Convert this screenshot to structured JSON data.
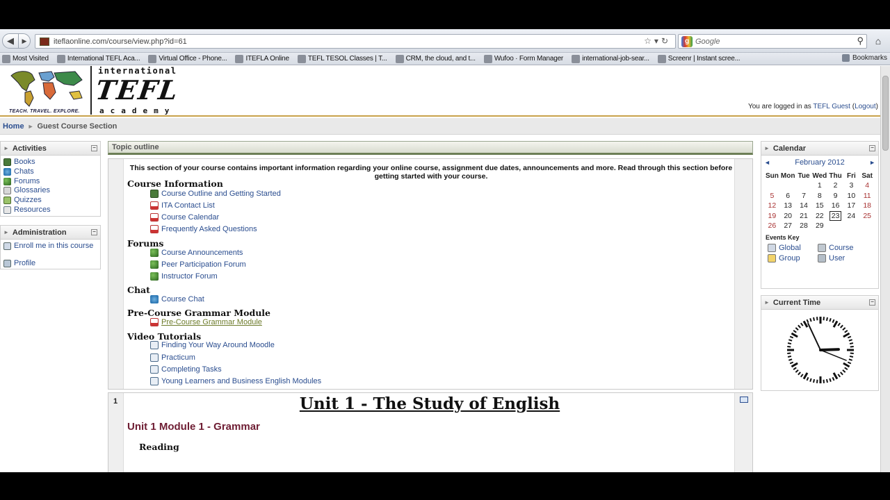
{
  "browser": {
    "url": "iteflaonline.com/course/view.php?id=61",
    "search_placeholder": "Google",
    "bookmarks": [
      "Most Visited",
      "International TEFL Aca...",
      "Virtual Office - Phone...",
      "ITEFLA Online",
      "TEFL TESOL Classes | T...",
      "CRM, the cloud, and t...",
      "Wufoo · Form Manager",
      "international-job-sear...",
      "Screenr | Instant scree..."
    ],
    "bookmarks_menu": "Bookmarks"
  },
  "header": {
    "logo_intl": "international",
    "logo_tefl": "TEFL",
    "logo_academy": "academy",
    "logo_tagline": "TEACH. TRAVEL. EXPLORE.",
    "login_prefix": "You are logged in as ",
    "login_user": "TEFL Guest",
    "logout": "Logout"
  },
  "breadcrumb": {
    "home": "Home",
    "separator": "►",
    "current": "Guest Course Section"
  },
  "activities": {
    "title": "Activities",
    "items": [
      {
        "label": "Books",
        "icon": "book-icon"
      },
      {
        "label": "Chats",
        "icon": "chat-icon"
      },
      {
        "label": "Forums",
        "icon": "forum-icon"
      },
      {
        "label": "Glossaries",
        "icon": "glossary-icon"
      },
      {
        "label": "Quizzes",
        "icon": "quiz-icon"
      },
      {
        "label": "Resources",
        "icon": "resource-icon"
      }
    ]
  },
  "administration": {
    "title": "Administration",
    "items": [
      {
        "label": "Enroll me in this course",
        "icon": "enroll-icon"
      },
      {
        "label": "Profile",
        "icon": "profile-icon"
      }
    ]
  },
  "topic": {
    "heading": "Topic outline",
    "summary": "This section of your course contains important information regarding your online course, assignment due dates, announcements and more. Read through this section before getting started with your course.",
    "sections": [
      {
        "title": "Course Information",
        "items": [
          {
            "label": "Course Outline and Getting Started",
            "icon": "book-icon"
          },
          {
            "label": "ITA Contact List",
            "icon": "pdf-icon"
          },
          {
            "label": "Course Calendar",
            "icon": "pdf-icon"
          },
          {
            "label": "Frequently Asked Questions",
            "icon": "pdf-icon"
          }
        ]
      },
      {
        "title": "Forums",
        "items": [
          {
            "label": "Course Announcements",
            "icon": "forum-icon"
          },
          {
            "label": "Peer Participation Forum",
            "icon": "forum-icon"
          },
          {
            "label": "Instructor Forum",
            "icon": "forum-icon"
          }
        ]
      },
      {
        "title": "Chat",
        "items": [
          {
            "label": "Course Chat",
            "icon": "chat-icon"
          }
        ]
      },
      {
        "title": "Pre-Course Grammar Module",
        "items": [
          {
            "label": "Pre-Course Grammar Module",
            "icon": "pdf-icon"
          }
        ]
      },
      {
        "title": "Video Tutorials",
        "items": [
          {
            "label": "Finding Your Way Around Moodle",
            "icon": "video-icon"
          },
          {
            "label": "Practicum",
            "icon": "video-icon"
          },
          {
            "label": "Completing Tasks",
            "icon": "video-icon"
          },
          {
            "label": "Young Learners and Business English Modules",
            "icon": "video-icon"
          }
        ]
      }
    ]
  },
  "unit": {
    "number": "1",
    "title": "Unit 1 - The Study of English",
    "module": "Unit 1 Module 1 - Grammar",
    "reading": "Reading"
  },
  "calendar": {
    "title": "Calendar",
    "month": "February 2012",
    "prev": "◄",
    "next": "►",
    "days": [
      "Sun",
      "Mon",
      "Tue",
      "Wed",
      "Thu",
      "Fri",
      "Sat"
    ],
    "weeks": [
      [
        "",
        "",
        "",
        "1",
        "2",
        "3",
        "4"
      ],
      [
        "5",
        "6",
        "7",
        "8",
        "9",
        "10",
        "11"
      ],
      [
        "12",
        "13",
        "14",
        "15",
        "16",
        "17",
        "18"
      ],
      [
        "19",
        "20",
        "21",
        "22",
        "23",
        "24",
        "25"
      ],
      [
        "26",
        "27",
        "28",
        "29",
        "",
        "",
        ""
      ]
    ],
    "today": "23",
    "events_key_title": "Events Key",
    "events_key": [
      "Global",
      "Course",
      "Group",
      "User"
    ]
  },
  "current_time": {
    "title": "Current Time"
  },
  "colors": {
    "link": "#2a4d8f",
    "unit_module": "#6e1d33",
    "visited_link": "#6d7b2a",
    "weekend": "#a83232"
  }
}
